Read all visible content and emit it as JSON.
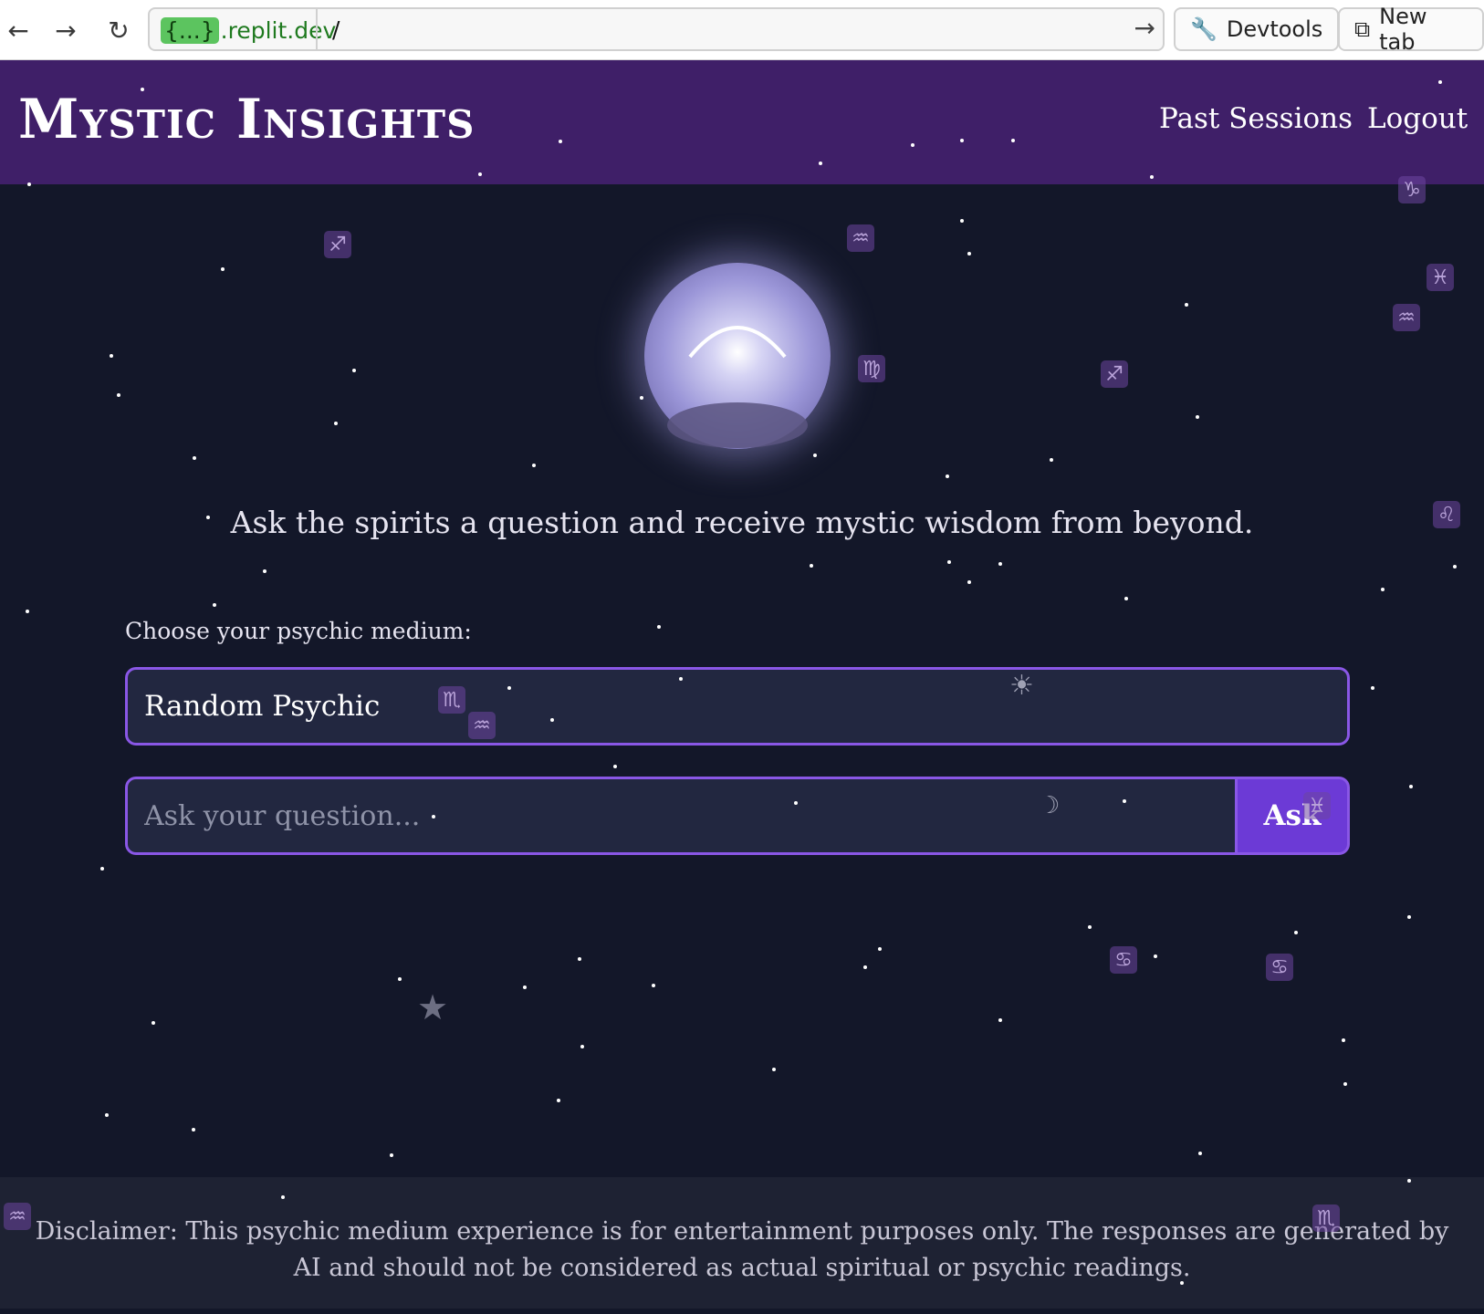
{
  "browser": {
    "back_icon": "arrow-left-icon",
    "forward_icon": "arrow-right-icon",
    "reload_icon": "reload-icon",
    "url_braces": "{...}",
    "url_domain": ".replit.dev",
    "url_path": "/",
    "devtools_label": "Devtools",
    "newtab_label": "New tab"
  },
  "header": {
    "title": "Mystic Insights",
    "nav": [
      {
        "label": "Past Sessions"
      },
      {
        "label": "Logout"
      }
    ]
  },
  "main": {
    "tagline": "Ask the spirits a question and receive mystic wisdom from beyond.",
    "medium_label": "Choose your psychic medium:",
    "medium_selected": "Random Psychic",
    "question_placeholder": "Ask your question...",
    "ask_label": "Ask"
  },
  "footer": {
    "disclaimer": "Disclaimer: This psychic medium experience is for entertainment purposes only. The responses are generated by AI and should not be considered as actual spiritual or psychic readings."
  },
  "colors": {
    "background": "#131729",
    "header": "#3f1f68",
    "accent": "#8a57e6",
    "button": "#6c3ad6"
  }
}
